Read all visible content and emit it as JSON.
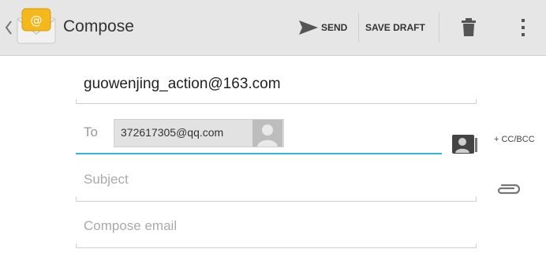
{
  "actionbar": {
    "title": "Compose",
    "send_label": "SEND",
    "save_draft_label": "SAVE DRAFT",
    "icons": [
      "back-chevron-icon",
      "email-app-icon",
      "send-icon",
      "trash-icon",
      "overflow-menu-icon"
    ]
  },
  "compose": {
    "from": "guowenjing_action@163.com",
    "to_label": "To",
    "recipients": [
      {
        "address": "372617305@qq.com"
      }
    ],
    "cc_bcc_label": "+ CC/BCC",
    "subject_placeholder": "Subject",
    "body_placeholder": "Compose email"
  },
  "colors": {
    "actionbar_bg": "#e6e6e6",
    "focus_underline": "#33b5e5",
    "app_icon_yellow": "#f4b81c"
  }
}
